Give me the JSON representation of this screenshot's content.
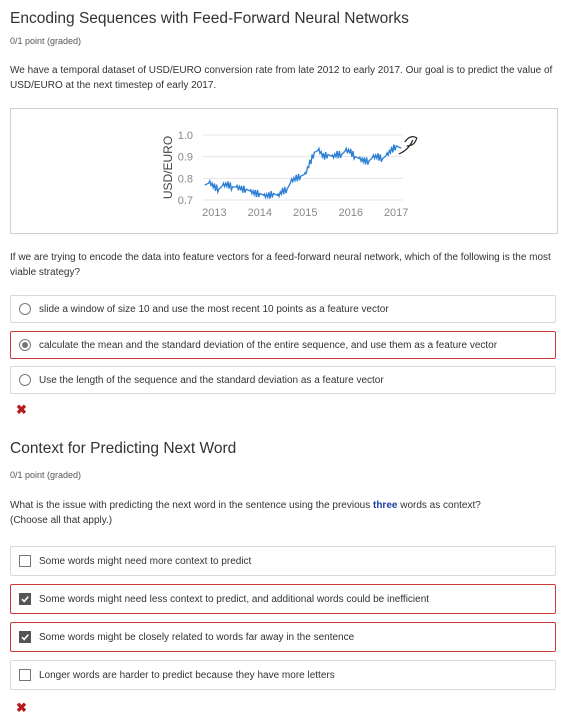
{
  "question1": {
    "title": "Encoding Sequences with Feed-Forward Neural Networks",
    "points": "0/1 point (graded)",
    "text": "We have a temporal dataset of USD/EURO conversion rate from late 2012 to early 2017. Our goal is to predict the value of USD/EURO at the next timestep of early 2017.",
    "prompt": "If we are trying to encode the data into feature vectors for a feed-forward neural network, which of the following is the most viable strategy?",
    "options": [
      {
        "label": "slide a window of size 10 and use the most recent 10 points as a feature vector",
        "selected": false
      },
      {
        "label": "calculate the mean and the standard deviation of the entire sequence, and use them as a feature vector",
        "selected": true
      },
      {
        "label": "Use the length of the sequence and the standard deviation as a feature vector",
        "selected": false
      }
    ],
    "result_icon": "cross-icon",
    "result_mark": "✖"
  },
  "question2": {
    "title": "Context for Predicting Next Word",
    "points": "0/1 point (graded)",
    "text_before": "What is the issue with predicting the next word in the sentence using the previous ",
    "text_bold": "three",
    "text_after": " words as context?",
    "text_line2": "(Choose all that apply.)",
    "options": [
      {
        "label": "Some words might need more context to predict",
        "checked": false
      },
      {
        "label": "Some words might need less context to predict, and additional words could be inefficient",
        "checked": true
      },
      {
        "label": "Some words might be closely related to words far away in the sentence",
        "checked": true
      },
      {
        "label": "Longer words are harder to predict because they have more letters",
        "checked": false
      }
    ],
    "result_icon": "cross-icon",
    "result_mark": "✖"
  },
  "colors": {
    "line": "#2b7fd4",
    "wrong": "#b71c1c",
    "selected_border": "#cf3838",
    "bold_word": "#1f3fa3"
  },
  "chart_data": {
    "type": "line",
    "ylabel": "USD/EURO",
    "xlabel": "",
    "title": "",
    "ylim": [
      0.7,
      1.0
    ],
    "yticks": [
      "0.7",
      "0.8",
      "0.9",
      "1.0"
    ],
    "xticks": [
      "2013",
      "2014",
      "2015",
      "2016",
      "2017"
    ],
    "grid": true,
    "x": [
      2012.8,
      2012.9,
      2013.0,
      2013.1,
      2013.2,
      2013.3,
      2013.4,
      2013.5,
      2013.6,
      2013.7,
      2013.8,
      2013.9,
      2014.0,
      2014.1,
      2014.2,
      2014.3,
      2014.4,
      2014.5,
      2014.6,
      2014.7,
      2014.8,
      2014.9,
      2015.0,
      2015.1,
      2015.2,
      2015.3,
      2015.4,
      2015.5,
      2015.6,
      2015.7,
      2015.8,
      2015.9,
      2016.0,
      2016.1,
      2016.2,
      2016.3,
      2016.4,
      2016.5,
      2016.6,
      2016.7,
      2016.8,
      2016.9,
      2017.0,
      2017.1
    ],
    "y": [
      0.77,
      0.78,
      0.76,
      0.75,
      0.77,
      0.77,
      0.76,
      0.76,
      0.75,
      0.75,
      0.74,
      0.73,
      0.73,
      0.72,
      0.72,
      0.73,
      0.72,
      0.74,
      0.75,
      0.79,
      0.8,
      0.81,
      0.82,
      0.87,
      0.92,
      0.93,
      0.9,
      0.91,
      0.9,
      0.91,
      0.91,
      0.93,
      0.92,
      0.9,
      0.89,
      0.88,
      0.88,
      0.9,
      0.9,
      0.89,
      0.91,
      0.93,
      0.95,
      0.94
    ]
  }
}
